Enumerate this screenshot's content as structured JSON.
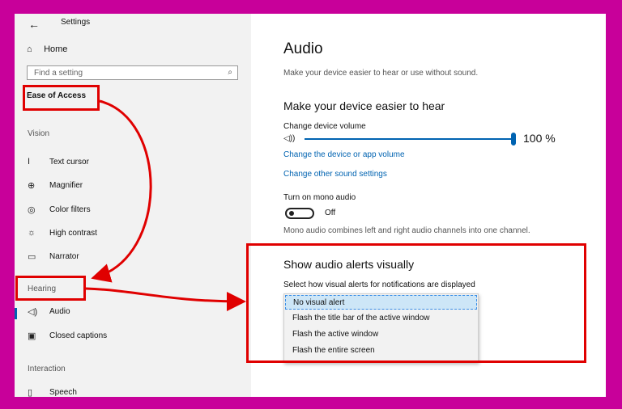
{
  "window": {
    "title": "Settings",
    "back_glyph": "←"
  },
  "sidebar": {
    "home": {
      "icon": "home-icon",
      "label": "Home"
    },
    "search": {
      "placeholder": "Find a setting",
      "icon": "search-icon"
    },
    "breadcrumb": "Ease of Access",
    "sections": {
      "vision": "Vision",
      "hearing": "Hearing",
      "interaction": "Interaction"
    },
    "vision_items": [
      {
        "icon": "text-cursor-icon",
        "label": "Text cursor"
      },
      {
        "icon": "magnifier-icon",
        "label": "Magnifier"
      },
      {
        "icon": "color-filters-icon",
        "label": "Color filters"
      },
      {
        "icon": "high-contrast-icon",
        "label": "High contrast"
      },
      {
        "icon": "narrator-icon",
        "label": "Narrator"
      }
    ],
    "hearing_items": [
      {
        "icon": "audio-icon",
        "label": "Audio",
        "active": true
      },
      {
        "icon": "closed-captions-icon",
        "label": "Closed captions",
        "active": false
      }
    ],
    "interaction_items": [
      {
        "icon": "speech-icon",
        "label": "Speech"
      }
    ]
  },
  "main": {
    "title": "Audio",
    "subtitle": "Make your device easier to hear or use without sound.",
    "section1_heading": "Make your device easier to hear",
    "volume_label": "Change device volume",
    "volume_value": "100 %",
    "volume_level": 1.0,
    "link_app_volume": "Change the device or app volume",
    "link_sound_settings": "Change other sound settings",
    "mono_label": "Turn on mono audio",
    "mono_state": "Off",
    "mono_description": "Mono audio combines left and right audio channels into one channel.",
    "section2_heading": "Show audio alerts visually",
    "alerts_label": "Select how visual alerts for notifications are displayed",
    "alert_options": [
      "No visual alert",
      "Flash the title bar of the active window",
      "Flash the active window",
      "Flash the entire screen"
    ],
    "selected_alert": "No visual alert"
  },
  "colors": {
    "accent": "#0063b1",
    "annotation": "#e00000",
    "background": "#c8009a"
  }
}
